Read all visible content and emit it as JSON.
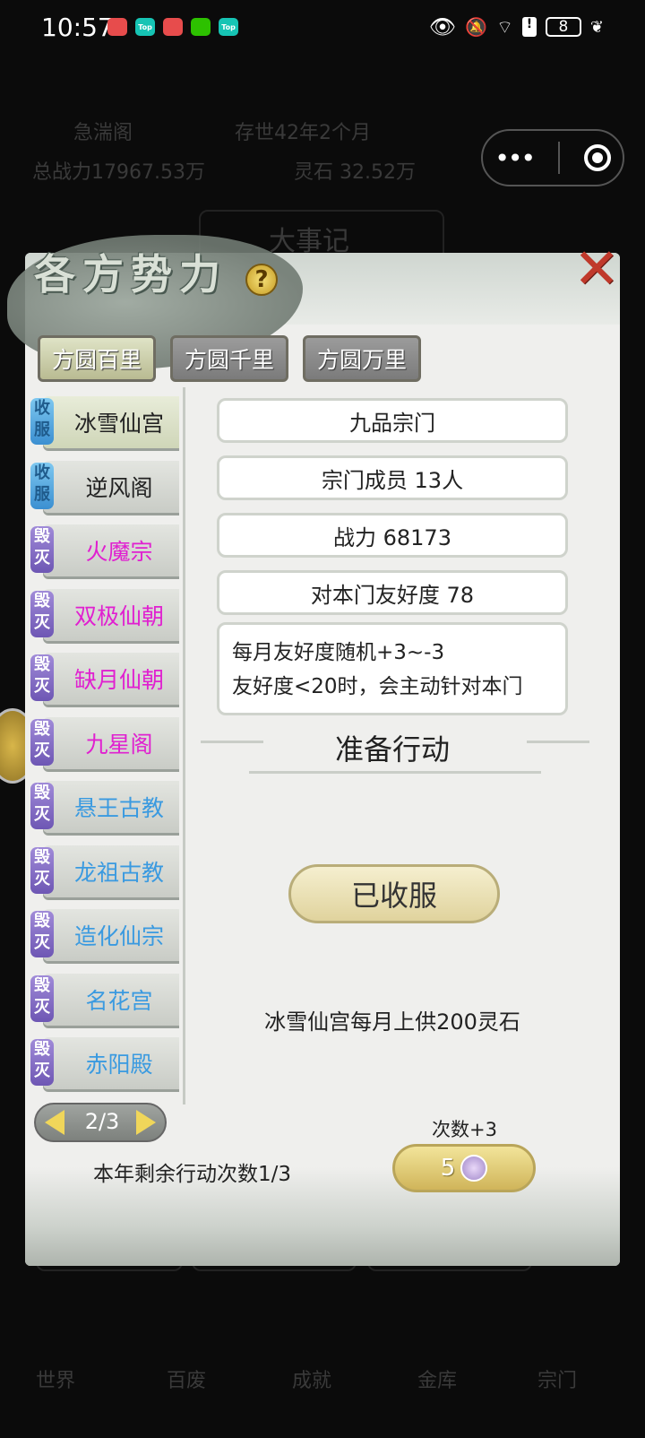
{
  "status_bar": {
    "time": "10:57",
    "notif_icons": [
      {
        "name": "app-red-icon",
        "label": "",
        "color": "#e74c4c"
      },
      {
        "name": "top-app-icon",
        "label": "Top",
        "color": "#16c4b4"
      },
      {
        "name": "app-red-icon",
        "label": "",
        "color": "#e74c4c"
      },
      {
        "name": "wechat-icon",
        "label": "",
        "color": "#2dc100"
      },
      {
        "name": "top-app-icon",
        "label": "Top",
        "color": "#16c4b4"
      }
    ],
    "battery": "8"
  },
  "background": {
    "sect_name": "急湍阁",
    "age": "存世42年2个月",
    "power": "总战力17967.53万",
    "spirit_stone": "灵石 32.52万",
    "tab_events": "大事记",
    "nav_items": [
      "世界",
      "百废",
      "成就",
      "金库",
      "宗门"
    ]
  },
  "dialog": {
    "title": "各方势力",
    "tabs": [
      {
        "label": "方圆百里",
        "active": true
      },
      {
        "label": "方圆千里",
        "active": false
      },
      {
        "label": "方圆万里",
        "active": false
      }
    ],
    "factions": [
      {
        "badge": "收服",
        "badge_type": "shoufu",
        "name": "冰雪仙宫",
        "color": "#222222",
        "selected": true
      },
      {
        "badge": "收服",
        "badge_type": "shoufu",
        "name": "逆风阁",
        "color": "#222222",
        "selected": false
      },
      {
        "badge": "毁灭",
        "badge_type": "huimie",
        "name": "火魔宗",
        "color": "#e020d0",
        "selected": false
      },
      {
        "badge": "毁灭",
        "badge_type": "huimie",
        "name": "双极仙朝",
        "color": "#e020d0",
        "selected": false
      },
      {
        "badge": "毁灭",
        "badge_type": "huimie",
        "name": "缺月仙朝",
        "color": "#e020d0",
        "selected": false
      },
      {
        "badge": "毁灭",
        "badge_type": "huimie",
        "name": "九星阁",
        "color": "#e020d0",
        "selected": false
      },
      {
        "badge": "毁灭",
        "badge_type": "huimie",
        "name": "悬王古教",
        "color": "#3a9ae0",
        "selected": false
      },
      {
        "badge": "毁灭",
        "badge_type": "huimie",
        "name": "龙祖古教",
        "color": "#3a9ae0",
        "selected": false
      },
      {
        "badge": "毁灭",
        "badge_type": "huimie",
        "name": "造化仙宗",
        "color": "#3a9ae0",
        "selected": false
      },
      {
        "badge": "毁灭",
        "badge_type": "huimie",
        "name": "名花宫",
        "color": "#3a9ae0",
        "selected": false
      },
      {
        "badge": "毁灭",
        "badge_type": "huimie",
        "name": "赤阳殿",
        "color": "#3a9ae0",
        "selected": false
      }
    ],
    "info": {
      "rank": "九品宗门",
      "members": "宗门成员 13人",
      "power": "战力 68173",
      "friendship": "对本门友好度 78",
      "desc_line1": "每月友好度随机+3~-3",
      "desc_line2": "友好度<20时，会主动针对本门"
    },
    "section_title": "准备行动",
    "action_button": "已收服",
    "tribute": "冰雪仙宫每月上供200灵石",
    "pager": "2/3",
    "remaining": "本年剩余行动次数1/3",
    "count_plus": "次数+3",
    "buy_cost": "5"
  }
}
